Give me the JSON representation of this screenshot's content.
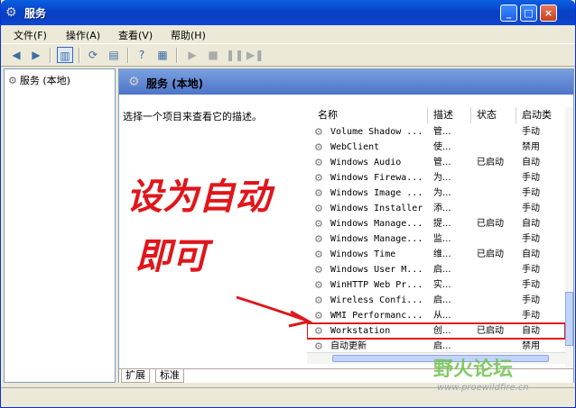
{
  "window": {
    "title": "服务"
  },
  "menu": [
    "文件(F)",
    "操作(A)",
    "查看(V)",
    "帮助(H)"
  ],
  "tree": {
    "item": "服务 (本地)"
  },
  "panel": {
    "header": "服务 (本地)",
    "description": "选择一个项目来查看它的描述。"
  },
  "columns": {
    "name": "名称",
    "desc": "描述",
    "status": "状态",
    "startup": "启动类"
  },
  "rows": [
    {
      "name": "Volume Shadow ...",
      "desc": "管...",
      "status": "",
      "startup": "手动"
    },
    {
      "name": "WebClient",
      "desc": "使...",
      "status": "",
      "startup": "禁用"
    },
    {
      "name": "Windows Audio",
      "desc": "管...",
      "status": "已启动",
      "startup": "自动"
    },
    {
      "name": "Windows Firewa...",
      "desc": "为...",
      "status": "",
      "startup": "手动"
    },
    {
      "name": "Windows Image ...",
      "desc": "为...",
      "status": "",
      "startup": "手动"
    },
    {
      "name": "Windows Installer",
      "desc": "添...",
      "status": "",
      "startup": "手动"
    },
    {
      "name": "Windows Manage...",
      "desc": "提...",
      "status": "已启动",
      "startup": "自动"
    },
    {
      "name": "Windows Manage...",
      "desc": "监...",
      "status": "",
      "startup": "手动"
    },
    {
      "name": "Windows Time",
      "desc": "维...",
      "status": "已启动",
      "startup": "自动"
    },
    {
      "name": "Windows User M...",
      "desc": "启...",
      "status": "",
      "startup": "手动"
    },
    {
      "name": "WinHTTP Web Pr...",
      "desc": "实...",
      "status": "",
      "startup": "手动"
    },
    {
      "name": "Wireless Confi...",
      "desc": "启...",
      "status": "",
      "startup": "手动"
    },
    {
      "name": "WMI Performanc...",
      "desc": "从...",
      "status": "",
      "startup": "手动"
    },
    {
      "name": "Workstation",
      "desc": "创...",
      "status": "已启动",
      "startup": "自动"
    },
    {
      "name": "自动更新",
      "desc": "启...",
      "status": "",
      "startup": "禁用"
    }
  ],
  "tabs": {
    "extended": "扩展",
    "standard": "标准"
  },
  "annotation": {
    "line1": "设为自动",
    "line2": "即可"
  },
  "watermark": {
    "name": "野火论坛",
    "url": "www.proewildfire.cn"
  },
  "colors": {
    "highlight": "#e01b1b",
    "annotation": "#e0161b",
    "titlebar": "#0842c9"
  }
}
